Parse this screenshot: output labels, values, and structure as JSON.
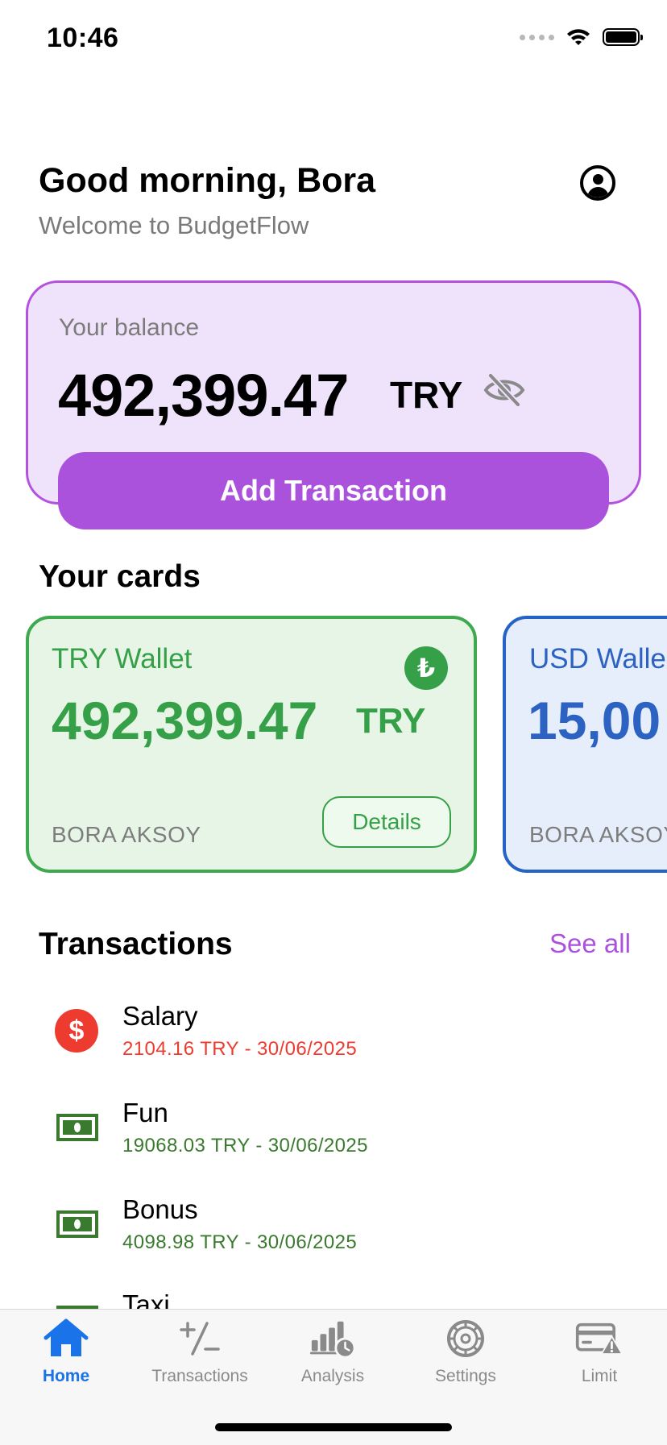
{
  "status_bar": {
    "time": "10:46"
  },
  "header": {
    "greeting": "Good morning, Bora",
    "subtitle": "Welcome to BudgetFlow"
  },
  "balance": {
    "label": "Your balance",
    "amount": "492,399.47",
    "currency": "TRY",
    "add_button": "Add Transaction"
  },
  "cards": {
    "title": "Your cards",
    "items": [
      {
        "title": "TRY Wallet",
        "amount": "492,399.47",
        "currency": "TRY",
        "symbol": "₺",
        "owner": "BORA AKSOY",
        "details": "Details",
        "color": "#35a047"
      },
      {
        "title": "USD Walle",
        "amount": "15,00",
        "owner": "BORA AKSOY",
        "color": "#2c63c2"
      }
    ]
  },
  "transactions": {
    "title": "Transactions",
    "see_all": "See all",
    "items": [
      {
        "name": "Salary",
        "detail": "2104.16 TRY - 30/06/2025",
        "icon": "dollar-icon",
        "color": "#ee3b30"
      },
      {
        "name": "Fun",
        "detail": "19068.03 TRY - 30/06/2025",
        "icon": "banknote-icon",
        "color": "#3a7a2e"
      },
      {
        "name": "Bonus",
        "detail": "4098.98 TRY - 30/06/2025",
        "icon": "banknote-icon",
        "color": "#3a7a2e"
      },
      {
        "name": "Taxi",
        "icon": "banknote-icon"
      }
    ]
  },
  "tabbar": {
    "items": [
      {
        "label": "Home",
        "icon": "home-icon",
        "active": true
      },
      {
        "label": "Transactions",
        "icon": "plus-minus-icon"
      },
      {
        "label": "Analysis",
        "icon": "chart-clock-icon"
      },
      {
        "label": "Settings",
        "icon": "gear-icon"
      },
      {
        "label": "Limit",
        "icon": "card-warning-icon"
      }
    ]
  }
}
